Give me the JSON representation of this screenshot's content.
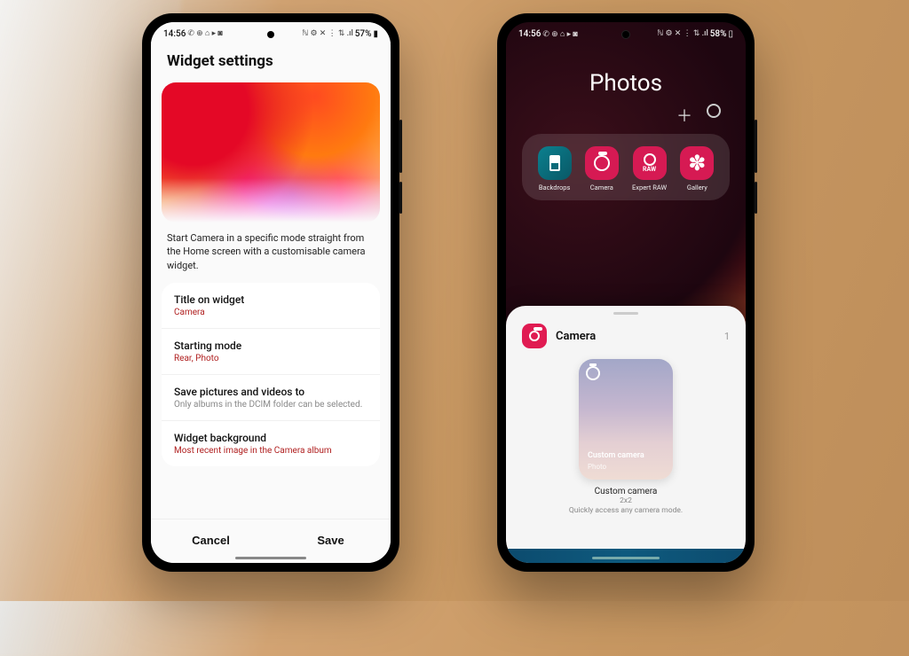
{
  "left_phone": {
    "status": {
      "time": "14:56",
      "left_icons": "✆ ⊕ ⌂ ▸ ◙",
      "right_icons": "ℕ ⚙ ✕ ⋮ ⇅ .ıl",
      "battery": "57%",
      "batt_glyph": "▮"
    },
    "title": "Widget settings",
    "description": "Start Camera in a specific mode straight from the Home screen with a customisable camera widget.",
    "rows": [
      {
        "label": "Title on widget",
        "value": "Camera",
        "gray": false
      },
      {
        "label": "Starting mode",
        "value": "Rear, Photo",
        "gray": false
      },
      {
        "label": "Save pictures and videos to",
        "value": "Only albums in the DCIM folder can be selected.",
        "gray": true
      },
      {
        "label": "Widget background",
        "value": "Most recent image in the Camera album",
        "gray": false
      }
    ],
    "cancel": "Cancel",
    "save": "Save"
  },
  "right_phone": {
    "status": {
      "time": "14:56",
      "left_icons": "✆ ⊕ ⌂ ▸ ◙",
      "right_icons": "ℕ ⚙ ✕ ⋮ ⇅ .ıl",
      "battery": "58%",
      "batt_glyph": "▯"
    },
    "folder_title": "Photos",
    "apps": [
      {
        "name": "Backdrops"
      },
      {
        "name": "Camera"
      },
      {
        "name": "Expert RAW"
      },
      {
        "name": "Gallery"
      }
    ],
    "sheet": {
      "app_name": "Camera",
      "count": "1",
      "widget_title": "Custom camera",
      "widget_subtitle": "Photo",
      "widget_name": "Custom camera",
      "widget_dims": "2x2",
      "widget_hint": "Quickly access any camera mode."
    }
  }
}
